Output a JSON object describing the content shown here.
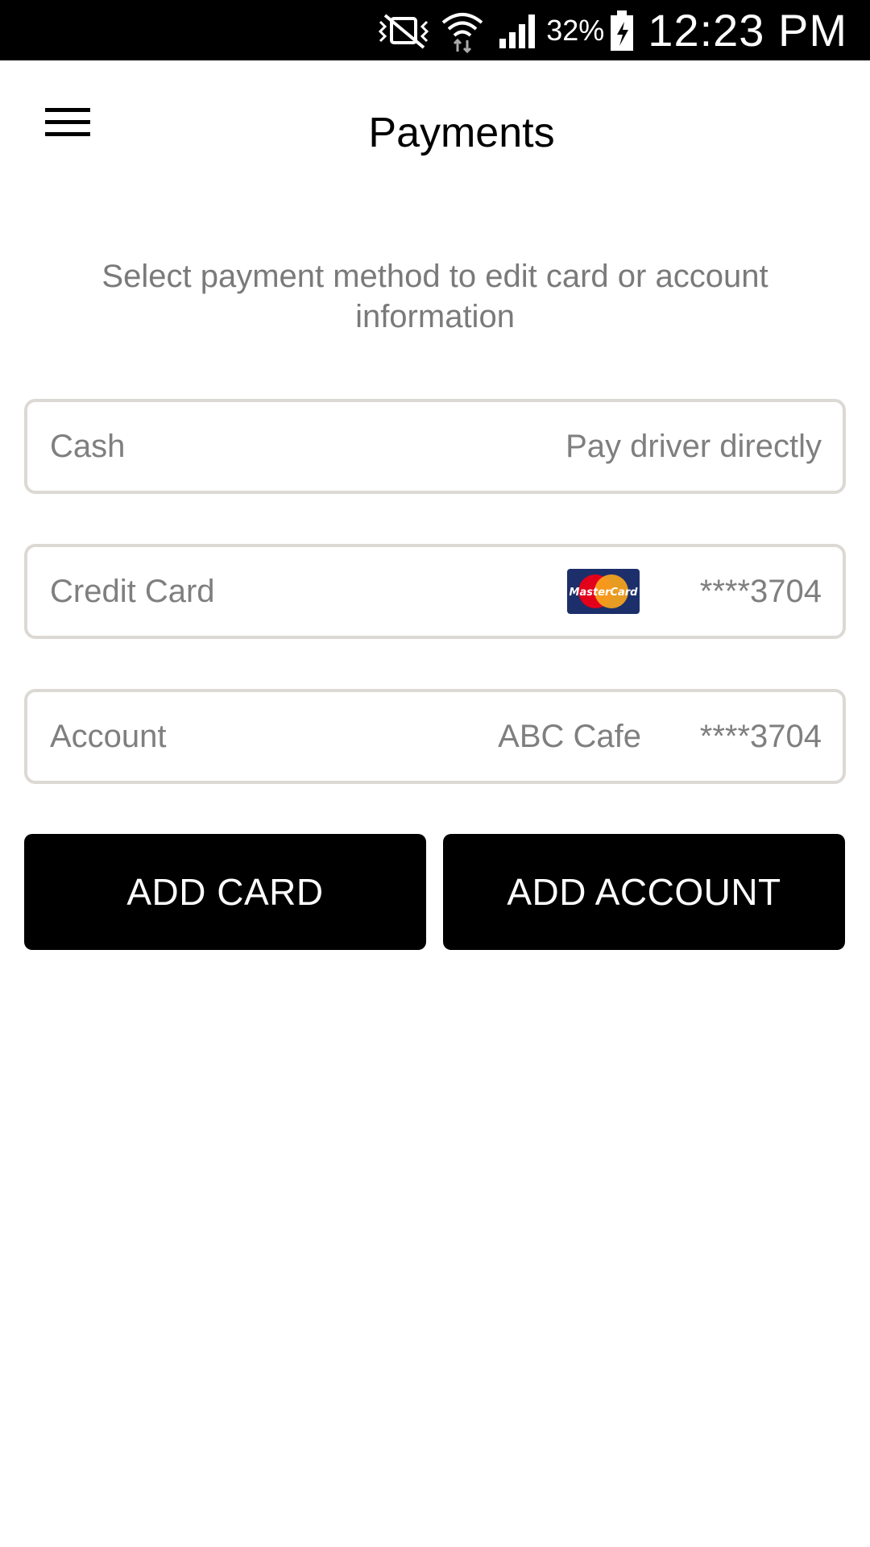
{
  "status_bar": {
    "battery_percent": "32%",
    "time": "12:23 PM",
    "icons": [
      "mute-vibrate-icon",
      "wifi-icon",
      "cell-signal-icon",
      "battery-charging-icon"
    ]
  },
  "header": {
    "title": "Payments",
    "menu_icon": "hamburger-menu-icon"
  },
  "instructions": "Select payment method to edit card or account information",
  "payment_methods": [
    {
      "label": "Cash",
      "detail": "Pay driver directly"
    },
    {
      "label": "Credit Card",
      "brand": "MasterCard",
      "number": "****3704"
    },
    {
      "label": "Account",
      "name": "ABC Cafe",
      "number": "****3704"
    }
  ],
  "buttons": {
    "add_card": "ADD CARD",
    "add_account": "ADD ACCOUNT"
  },
  "colors": {
    "status_bar_bg": "#000000",
    "row_border": "#dcd9d4",
    "secondary_text": "#7f7f7f",
    "button_bg": "#000000",
    "button_text": "#ffffff",
    "mastercard_bg": "#1c2f6b",
    "mastercard_red": "#e3001b",
    "mastercard_yellow": "#f7a51c"
  }
}
